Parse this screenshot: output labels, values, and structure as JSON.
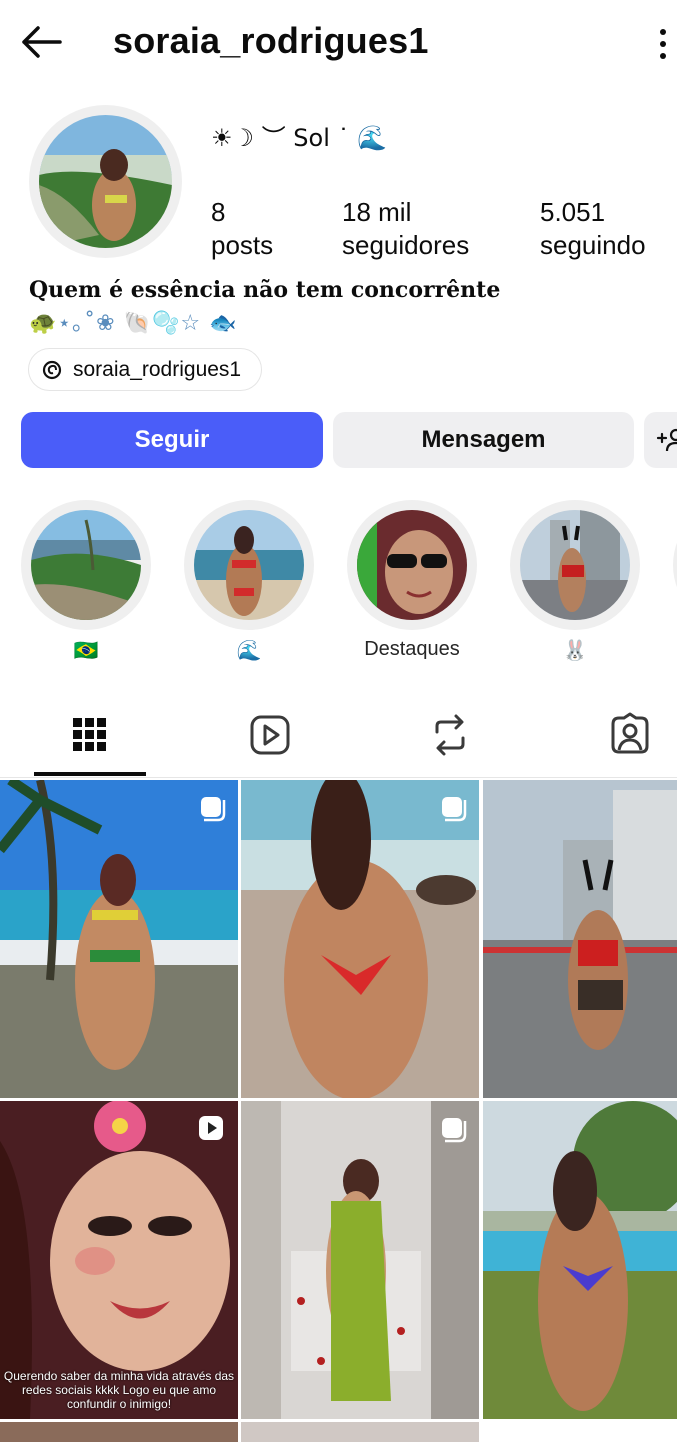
{
  "header": {
    "username": "soraia_rodrigues1",
    "back_icon": "arrow-left-icon",
    "menu_icon": "more-vertical-icon"
  },
  "profile": {
    "display_name": "☀︎☽ ︶ Sol ˙ 🌊",
    "stats": {
      "posts_count": "8",
      "posts_label": "posts",
      "followers_count": "18 mil",
      "followers_label": "seguidores",
      "following_count": "5.051",
      "following_label": "seguindo"
    },
    "bio_line1": "Quem é essência não tem concorrênte",
    "bio_line2": "🐢⋆｡˚❀ 🐚🫧☆ 🐟",
    "threads_handle": "soraia_rodrigues1"
  },
  "actions": {
    "follow_label": "Seguir",
    "message_label": "Mensagem"
  },
  "highlights": [
    {
      "caption": "🇧🇷"
    },
    {
      "caption": "🌊"
    },
    {
      "caption": "Destaques"
    },
    {
      "caption": "🐰"
    }
  ],
  "tabs": [
    "grid-icon",
    "reels-icon",
    "reposts-icon",
    "tagged-icon"
  ],
  "posts": [
    {
      "badge": "carousel-icon",
      "caption": ""
    },
    {
      "badge": "carousel-icon",
      "caption": ""
    },
    {
      "badge": "",
      "caption": ""
    },
    {
      "badge": "reel-icon",
      "caption": "Querendo saber da minha vida através das redes sociais kkkk Logo eu que amo confundir o inimigo!"
    },
    {
      "badge": "carousel-icon",
      "caption": ""
    },
    {
      "badge": "",
      "caption": ""
    }
  ],
  "colors": {
    "accent": "#4a5df9",
    "secondary_button": "#efeff1",
    "ring": "#efefef",
    "text": "#0c0c0c"
  }
}
